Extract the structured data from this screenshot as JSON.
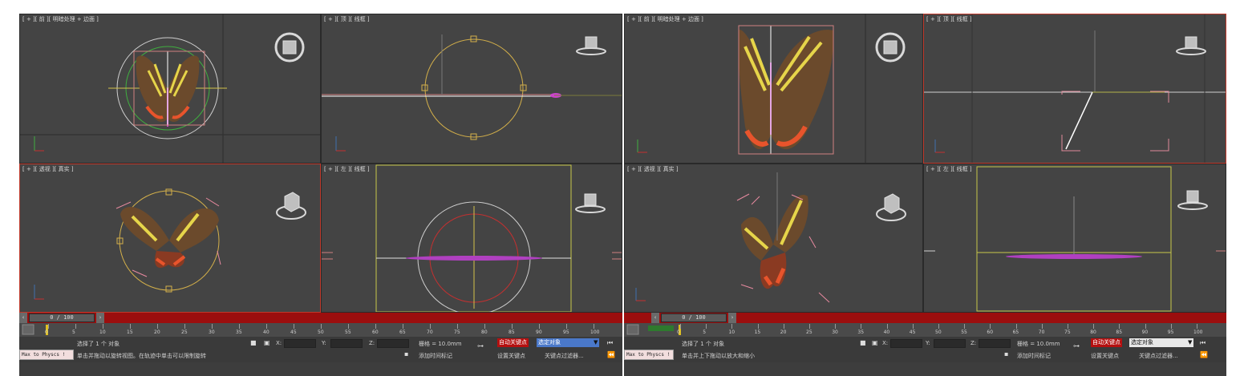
{
  "panels": [
    {
      "viewports": {
        "top_left": "[ + ][ 前 ][ 明暗处理 + 边面 ]",
        "top_right": "[ + ][ 顶 ][ 线框 ]",
        "bottom_left": "[ + ][ 透视 ][ 真实 ]",
        "bottom_right": "[ + ][ 左 ][ 线框 ]"
      },
      "time_slider": "0 / 100",
      "status": {
        "selected": "选择了 1 个 对象",
        "prompt": "单击并拖动以旋转视图。在轨迹中单击可以限制旋转",
        "x_label": "X:",
        "y_label": "Y:",
        "z_label": "Z:",
        "grid": "栅格 = 10.0mm",
        "add_time_tag": "添加时间标记",
        "auto_key": "自动关键点",
        "set_key": "设置关键点",
        "selected_objects": "选定对象",
        "key_filters": "关键点过滤器..."
      },
      "script_label": "Max to Physcs !"
    },
    {
      "viewports": {
        "top_left": "[ + ][ 前 ][ 明暗处理 + 边面 ]",
        "top_right": "[ + ][ 顶 ][ 线框 ]",
        "bottom_left": "[ + ][ 透视 ][ 真实 ]",
        "bottom_right": "[ + ][ 左 ][ 线框 ]"
      },
      "time_slider": "0 / 100",
      "status": {
        "selected": "选择了 1 个 对象",
        "prompt": "单击并上下拖动以放大和缩小",
        "x_label": "X:",
        "y_label": "Y:",
        "z_label": "Z:",
        "grid": "栅格 = 10.0mm",
        "add_time_tag": "添加时间标记",
        "auto_key": "自动关键点",
        "set_key": "设置关键点",
        "selected_objects": "选定对象",
        "key_filters": "关键点过滤器..."
      },
      "script_label": "Max to Physcs !"
    }
  ],
  "timeline_ticks": [
    "0",
    "5",
    "10",
    "15",
    "20",
    "25",
    "30",
    "35",
    "40",
    "45",
    "50",
    "55",
    "60",
    "65",
    "70",
    "75",
    "80",
    "85",
    "90",
    "95",
    "100"
  ],
  "colors": {
    "viewport_bg": "#444444",
    "active_border": "#c0392b",
    "timebar_red": "#9b0e0e",
    "gizmo_yellow": "#d4b04a",
    "gizmo_magenta": "#cc44cc",
    "gizmo_green": "#3fae3f"
  }
}
